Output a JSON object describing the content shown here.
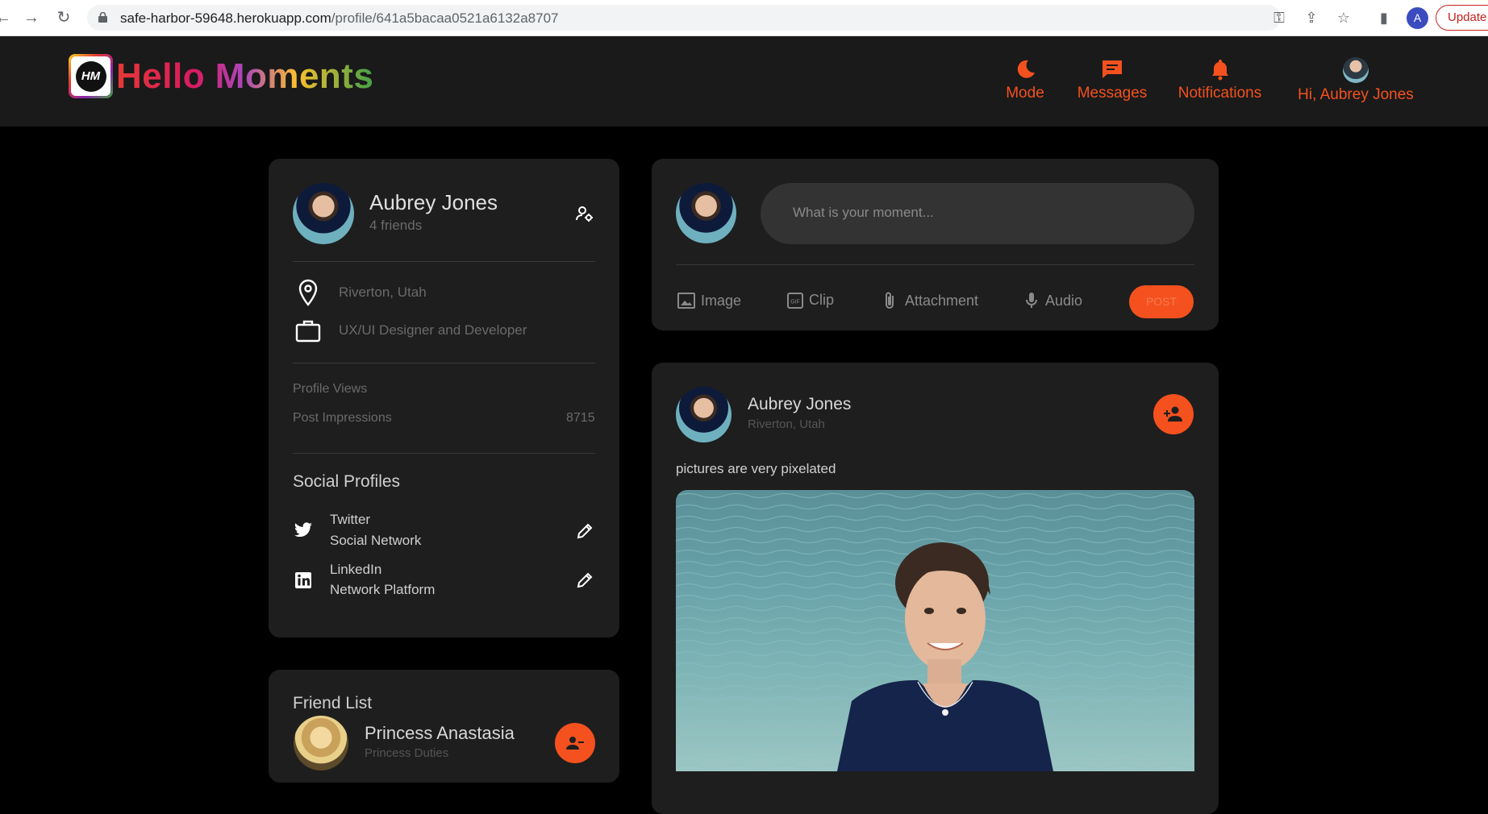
{
  "browser": {
    "url_host": "safe-harbor-59648.herokuapp.com",
    "url_path": "/profile/641a5bacaa0521a6132a8707",
    "profile_initial": "A",
    "update_label": "Update"
  },
  "header": {
    "logo_text": "Hello Moments",
    "logo_initials": "HM",
    "nav": [
      {
        "label": "Mode",
        "icon": "moon-icon"
      },
      {
        "label": "Messages",
        "icon": "message-icon"
      },
      {
        "label": "Notifications",
        "icon": "bell-icon"
      },
      {
        "label": "Hi, Aubrey Jones",
        "icon": "avatar"
      }
    ],
    "accent": "#f4511e"
  },
  "profile": {
    "name": "Aubrey Jones",
    "friends": "4 friends",
    "location": "Riverton, Utah",
    "occupation": "UX/UI Designer and Developer",
    "stats": [
      {
        "label": "Profile Views",
        "value": ""
      },
      {
        "label": "Post Impressions",
        "value": "8715"
      }
    ],
    "social_title": "Social Profiles",
    "social": [
      {
        "name": "Twitter",
        "desc": "Social Network",
        "icon": "twitter-icon"
      },
      {
        "name": "LinkedIn",
        "desc": "Network Platform",
        "icon": "linkedin-icon"
      }
    ]
  },
  "friends": {
    "title": "Friend List",
    "items": [
      {
        "name": "Princess Anastasia",
        "subtitle": "Princess Duties"
      }
    ]
  },
  "composer": {
    "placeholder": "What is your moment...",
    "options": [
      {
        "label": "Image",
        "icon": "image-icon"
      },
      {
        "label": "Clip",
        "icon": "gif-icon"
      },
      {
        "label": "Attachment",
        "icon": "paperclip-icon"
      },
      {
        "label": "Audio",
        "icon": "mic-icon"
      }
    ],
    "post_label": "POST"
  },
  "post": {
    "author": "Aubrey Jones",
    "location": "Riverton, Utah",
    "text": "pictures are very pixelated"
  }
}
